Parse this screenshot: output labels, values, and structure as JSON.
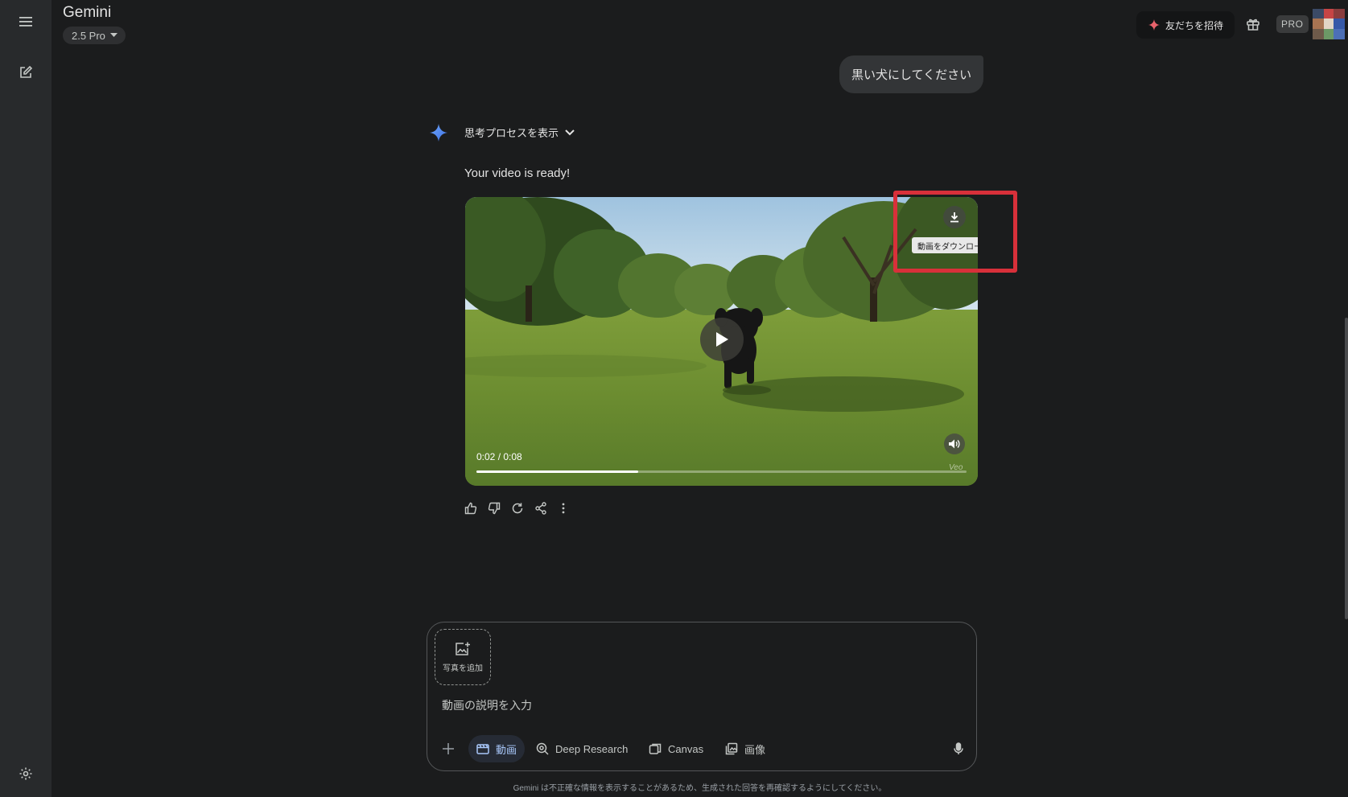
{
  "header": {
    "app_title": "Gemini",
    "model": "2.5 Pro",
    "invite_label": "友だちを招待",
    "pro_badge": "PRO"
  },
  "conversation": {
    "user_message": "黒い犬にしてください",
    "thought_toggle_label": "思考プロセスを表示",
    "response_text": "Your video is ready!",
    "video": {
      "current_time": "0:02",
      "duration": "0:08",
      "time_display": "0:02 / 0:08",
      "progress_fraction": 0.33,
      "download_tooltip": "動画をダウンロード",
      "watermark": "Veo"
    }
  },
  "input": {
    "add_photo_label": "写真を追加",
    "placeholder": "動画の説明を入力",
    "tools": [
      "動画",
      "Deep Research",
      "Canvas",
      "画像"
    ],
    "active_tool": "動画"
  },
  "footer": {
    "disclaimer": "Gemini は不正確な情報を表示することがあるため、生成された回答を再確認するようにしてください。"
  },
  "colors": {
    "background": "#1b1c1d",
    "sidebar": "#282a2c",
    "accent_blue": "#a8c7fa",
    "highlight_red": "#d8303a"
  },
  "icons": [
    "menu-icon",
    "new-chat-icon",
    "settings-icon",
    "sparkle-icon",
    "gift-icon",
    "chevron-down-icon",
    "play-icon",
    "download-icon",
    "volume-icon",
    "thumbs-up-icon",
    "thumbs-down-icon",
    "regenerate-icon",
    "share-icon",
    "more-icon",
    "add-image-icon",
    "plus-icon",
    "video-icon",
    "deep-research-icon",
    "canvas-icon",
    "image-icon",
    "mic-icon"
  ]
}
